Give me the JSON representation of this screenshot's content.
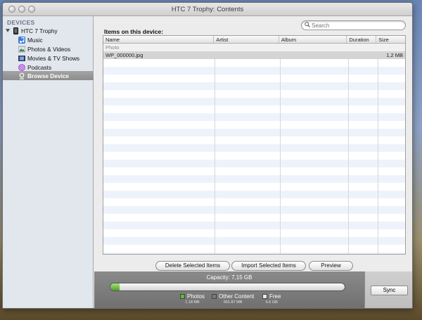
{
  "window": {
    "title": "HTC 7 Trophy: Contents"
  },
  "sidebar": {
    "header": "DEVICES",
    "device": {
      "label": "HTC 7 Trophy",
      "icon": "phone-icon"
    },
    "items": [
      {
        "label": "Music",
        "icon": "music-note-icon"
      },
      {
        "label": "Photos & Videos",
        "icon": "photos-icon"
      },
      {
        "label": "Movies & TV Shows",
        "icon": "film-icon"
      },
      {
        "label": "Podcasts",
        "icon": "podcast-icon"
      },
      {
        "label": "Browse Device",
        "icon": "browse-device-icon",
        "selected": true
      }
    ]
  },
  "search": {
    "placeholder": "Search",
    "value": ""
  },
  "main": {
    "items_label": "Items on this device:",
    "columns": [
      "Name",
      "Artist",
      "Album",
      "Duration",
      "Size"
    ],
    "group": "Photo",
    "rows": [
      {
        "name": "WP_000000.jpg",
        "artist": "",
        "album": "",
        "duration": "",
        "size": "1,2 MB"
      }
    ]
  },
  "buttons": {
    "delete": "Delete Selected Items",
    "import": "Import Selected Items",
    "preview": "Preview",
    "sync": "Sync"
  },
  "capacity": {
    "label": "Capacity: 7,15 GB",
    "photos_fraction": 0.04,
    "other_fraction": 0.0,
    "legend": [
      {
        "name": "Photos",
        "value": "1.18 MB",
        "color": "#5cb935"
      },
      {
        "name": "Other Content",
        "value": "551.87 MB",
        "color": "#7a7a7a"
      },
      {
        "name": "Free",
        "value": "6.6 GB",
        "color": "#e9e9e9"
      }
    ]
  }
}
